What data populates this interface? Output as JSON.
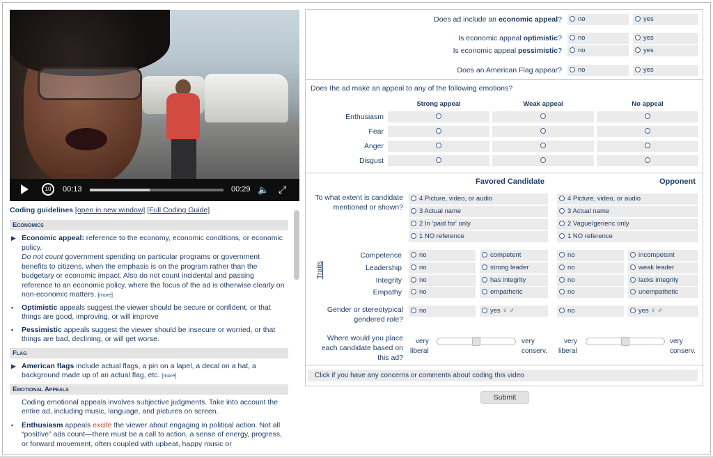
{
  "video": {
    "current_time": "00:13",
    "duration": "00:29",
    "progress_fraction": 0.45,
    "rewind_label": "10"
  },
  "guidelines": {
    "title": "Coding guidelines",
    "open_new_window": "[open in new window]",
    "full_guide": "[Full Coding Guide]",
    "sections": {
      "economics": "Economics",
      "flag": "Flag",
      "emotional": "Emotional Appeals"
    },
    "items": {
      "economic_appeal_title": "Economic appeal:",
      "economic_appeal_text": " reference to the economy, economic conditions, or economic policy.",
      "economic_appeal_dnc_em": "Do not count",
      "economic_appeal_dnc_text": " government spending on particular programs or government benefits to citizens, when the emphasis is on the program rather than the budgetary or economic impact. Also do not count incidental and passing reference to an economic policy, where the focus of the ad is otherwise clearly on non-economic matters. ",
      "more1": "[more]",
      "optimistic_title": "Optimistic",
      "optimistic_text": " appeals suggest the viewer should be secure or confident, or that things are good, improving, or will improve",
      "pessimistic_title": "Pessimistic",
      "pessimistic_text": " appeals suggest the viewer should be insecure or worried, or that things are bad, declining, or will get worse.",
      "flag_title": "American flags",
      "flag_text": " include actual flags, a pin on a lapel, a decal on a hat, a background made up of an actual flag, etc. ",
      "more2": "[more]",
      "emotional_intro": "Coding emotional appeals involves subjective judgments. Take into account the entire ad, including music, language, and pictures on screen.",
      "enthusiasm_title": "Enthusiasm",
      "enthusiasm_text1": " appeals ",
      "enthusiasm_excite": "excite",
      "enthusiasm_text2": " the viewer about engaging in political action. Not all “positive” ads count—there must be a call to action, a sense of energy, progress, or forward movement, often coupled with upbeat, happy music or"
    }
  },
  "form": {
    "econ_q1": "Does ad include an ",
    "econ_q1_b": "economic appeal",
    "econ_q1_end": "?",
    "econ_q2": "Is economic appeal ",
    "econ_q2_b": "optimistic",
    "econ_q2_end": "?",
    "econ_q3": "Is economic appeal ",
    "econ_q3_b": "pessimistic",
    "econ_q3_end": "?",
    "flag_q": "Does an American Flag appear?",
    "no": "no",
    "yes": "yes",
    "emotions_q": "Does the ad make an appeal to any of the following emotions?",
    "emotion_cols": [
      "Strong appeal",
      "Weak appeal",
      "No appeal"
    ],
    "emotions": [
      "Enthusiasm",
      "Fear",
      "Anger",
      "Disgust"
    ],
    "favored": "Favored Candidate",
    "opponent": "Opponent",
    "mention_q": "To what extent is candidate mentioned or shown?",
    "favored_mention": [
      "4 Picture, video, or audio",
      "3 Actual name",
      "2 In 'paid for' only",
      "1 NO reference"
    ],
    "opponent_mention": [
      "4 Picture, video, or audio",
      "3 Actual name",
      "2 Vague/generic only",
      "1 NO reference"
    ],
    "traits_label": "Traits",
    "traits": [
      "Competence",
      "Leadership",
      "Integrity",
      "Empathy"
    ],
    "favored_traits": [
      "competent",
      "strong leader",
      "has integrity",
      "empathetic"
    ],
    "opponent_traits": [
      "incompetent",
      "weak leader",
      "lacks integrity",
      "unempathetic"
    ],
    "gender_q": "Gender or stereotypical gendered role?",
    "gender_yes": "yes ♀ ♂",
    "place_q": "Where would you place each candidate based on this ad?",
    "very": "very",
    "liberal": "liberal",
    "conserv": "conserv.",
    "concerns": "Click if you have any concerns or comments about coding this video",
    "submit": "Submit"
  }
}
